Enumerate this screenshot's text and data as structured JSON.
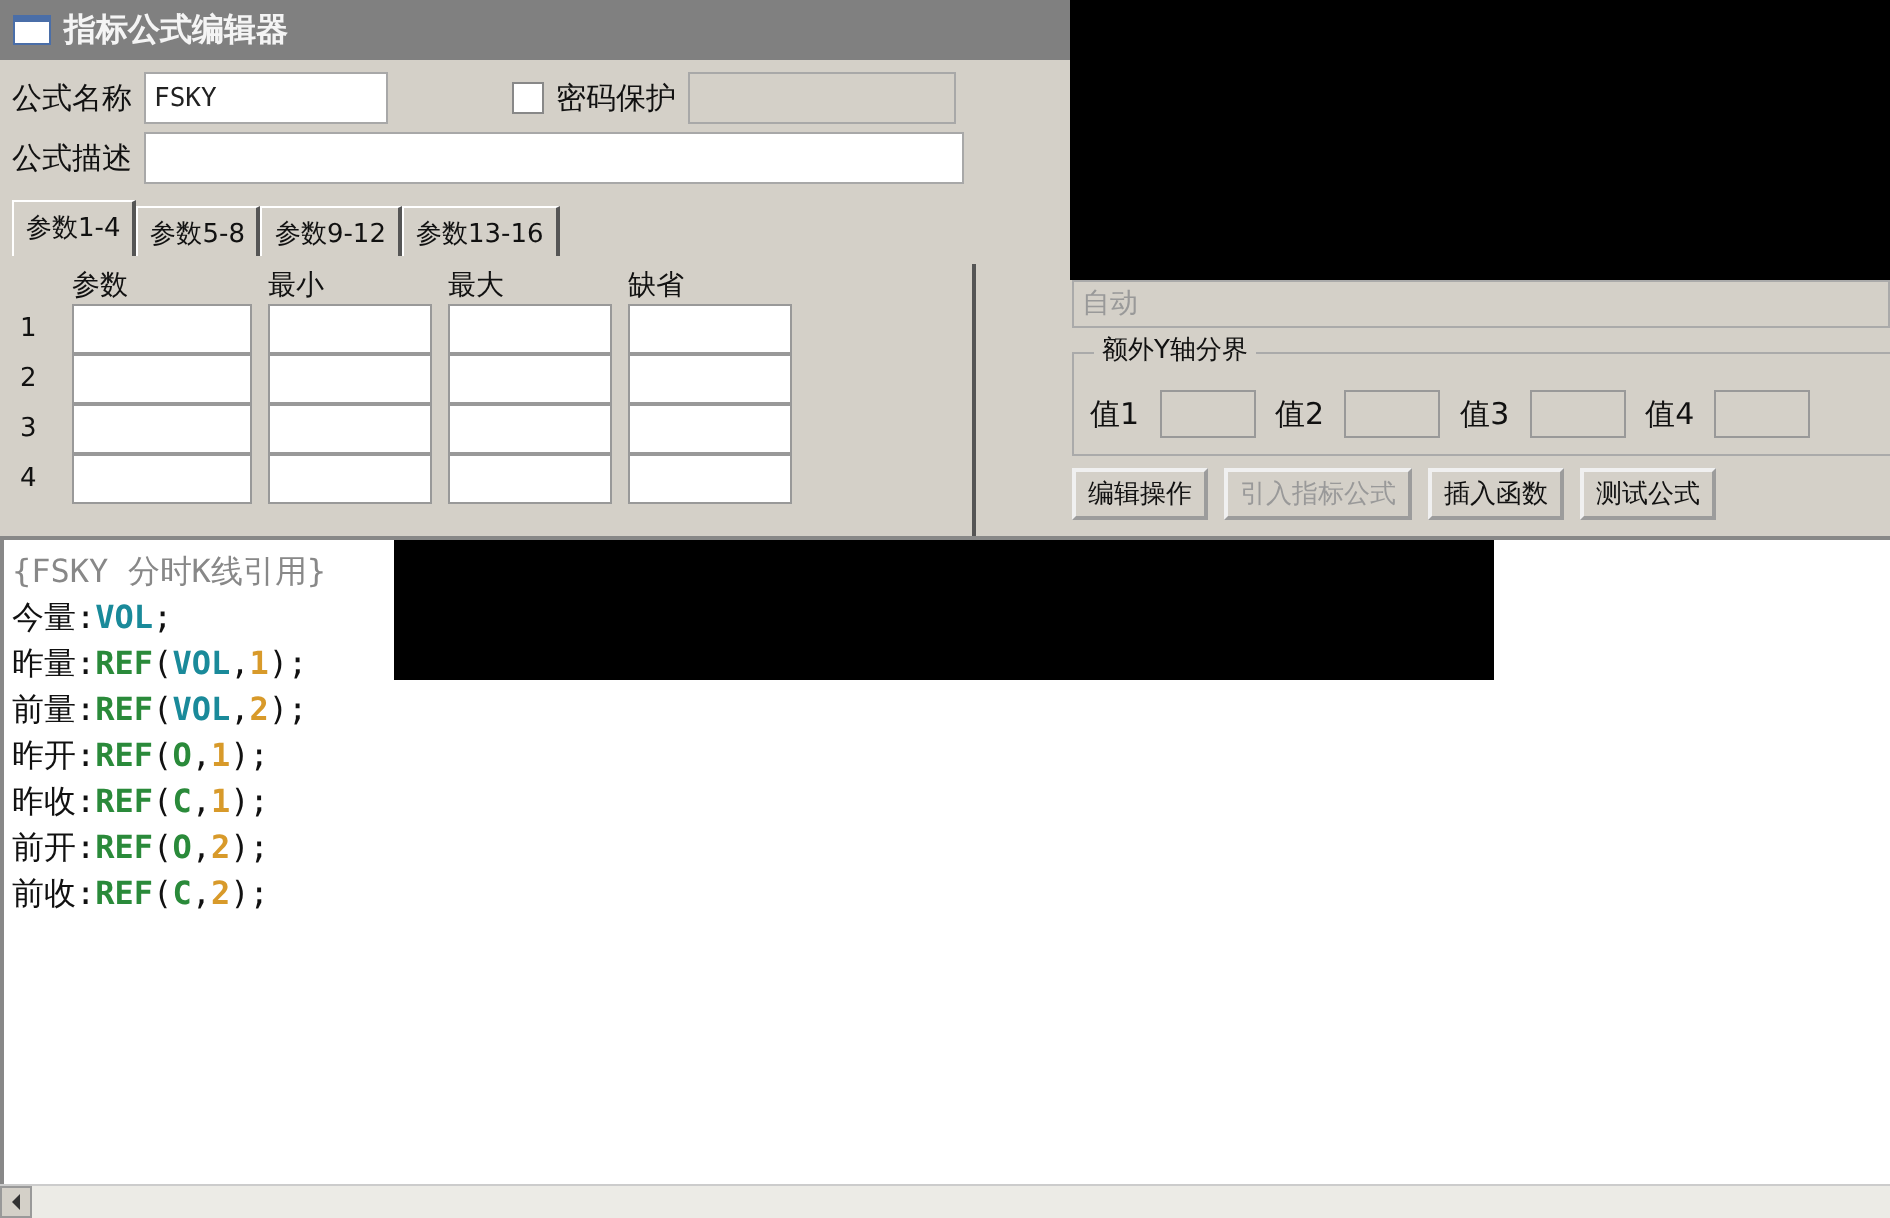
{
  "window": {
    "title": "指标公式编辑器"
  },
  "form": {
    "name_label": "公式名称",
    "name_value": "FSKY",
    "password": {
      "label": "密码保护",
      "checked": false
    },
    "desc_label": "公式描述"
  },
  "tabs": [
    {
      "label": "参数1-4",
      "selected": true
    },
    {
      "label": "参数5-8",
      "selected": false
    },
    {
      "label": "参数9-12",
      "selected": false
    },
    {
      "label": "参数13-16",
      "selected": false
    }
  ],
  "params": {
    "columns": [
      "参数",
      "最小",
      "最大",
      "缺省"
    ],
    "rows": [
      "1",
      "2",
      "3",
      "4"
    ]
  },
  "axis_field": {
    "value": "自动"
  },
  "y_bounds": {
    "title": "额外Y轴分界",
    "fields": [
      "值1",
      "值2",
      "值3",
      "值4"
    ]
  },
  "buttons": [
    {
      "label": "编辑操作",
      "disabled": false
    },
    {
      "label": "引入指标公式",
      "disabled": true
    },
    {
      "label": "插入函数",
      "disabled": false
    },
    {
      "label": "测试公式",
      "disabled": false
    }
  ],
  "code": {
    "comment": "{FSKY 分时K线引用}",
    "lines": [
      [
        {
          "kind": "name",
          "text": "今量"
        },
        {
          "kind": "punct",
          "text": ":"
        },
        {
          "kind": "var",
          "text": "VOL"
        },
        {
          "kind": "punct",
          "text": ";"
        }
      ],
      [
        {
          "kind": "name",
          "text": "昨量"
        },
        {
          "kind": "punct",
          "text": ":"
        },
        {
          "kind": "func",
          "text": "REF"
        },
        {
          "kind": "punct",
          "text": "("
        },
        {
          "kind": "var",
          "text": "VOL"
        },
        {
          "kind": "punct",
          "text": ","
        },
        {
          "kind": "num",
          "text": "1"
        },
        {
          "kind": "punct",
          "text": ");"
        }
      ],
      [
        {
          "kind": "name",
          "text": "前量"
        },
        {
          "kind": "punct",
          "text": ":"
        },
        {
          "kind": "func",
          "text": "REF"
        },
        {
          "kind": "punct",
          "text": "("
        },
        {
          "kind": "var",
          "text": "VOL"
        },
        {
          "kind": "punct",
          "text": ","
        },
        {
          "kind": "num",
          "text": "2"
        },
        {
          "kind": "punct",
          "text": ");"
        }
      ],
      [
        {
          "kind": "name",
          "text": "昨开"
        },
        {
          "kind": "punct",
          "text": ":"
        },
        {
          "kind": "func",
          "text": "REF"
        },
        {
          "kind": "punct",
          "text": "("
        },
        {
          "kind": "func",
          "text": "O"
        },
        {
          "kind": "punct",
          "text": ","
        },
        {
          "kind": "num",
          "text": "1"
        },
        {
          "kind": "punct",
          "text": ");"
        }
      ],
      [
        {
          "kind": "name",
          "text": "昨收"
        },
        {
          "kind": "punct",
          "text": ":"
        },
        {
          "kind": "func",
          "text": "REF"
        },
        {
          "kind": "punct",
          "text": "("
        },
        {
          "kind": "func",
          "text": "C"
        },
        {
          "kind": "punct",
          "text": ","
        },
        {
          "kind": "num",
          "text": "1"
        },
        {
          "kind": "punct",
          "text": ");"
        }
      ],
      [
        {
          "kind": "name",
          "text": "前开"
        },
        {
          "kind": "punct",
          "text": ":"
        },
        {
          "kind": "func",
          "text": "REF"
        },
        {
          "kind": "punct",
          "text": "("
        },
        {
          "kind": "func",
          "text": "O"
        },
        {
          "kind": "punct",
          "text": ","
        },
        {
          "kind": "num",
          "text": "2"
        },
        {
          "kind": "punct",
          "text": ");"
        }
      ],
      [
        {
          "kind": "name",
          "text": "前收"
        },
        {
          "kind": "punct",
          "text": ":"
        },
        {
          "kind": "func",
          "text": "REF"
        },
        {
          "kind": "punct",
          "text": "("
        },
        {
          "kind": "func",
          "text": "C"
        },
        {
          "kind": "punct",
          "text": ","
        },
        {
          "kind": "num",
          "text": "2"
        },
        {
          "kind": "punct",
          "text": ");"
        }
      ]
    ]
  }
}
